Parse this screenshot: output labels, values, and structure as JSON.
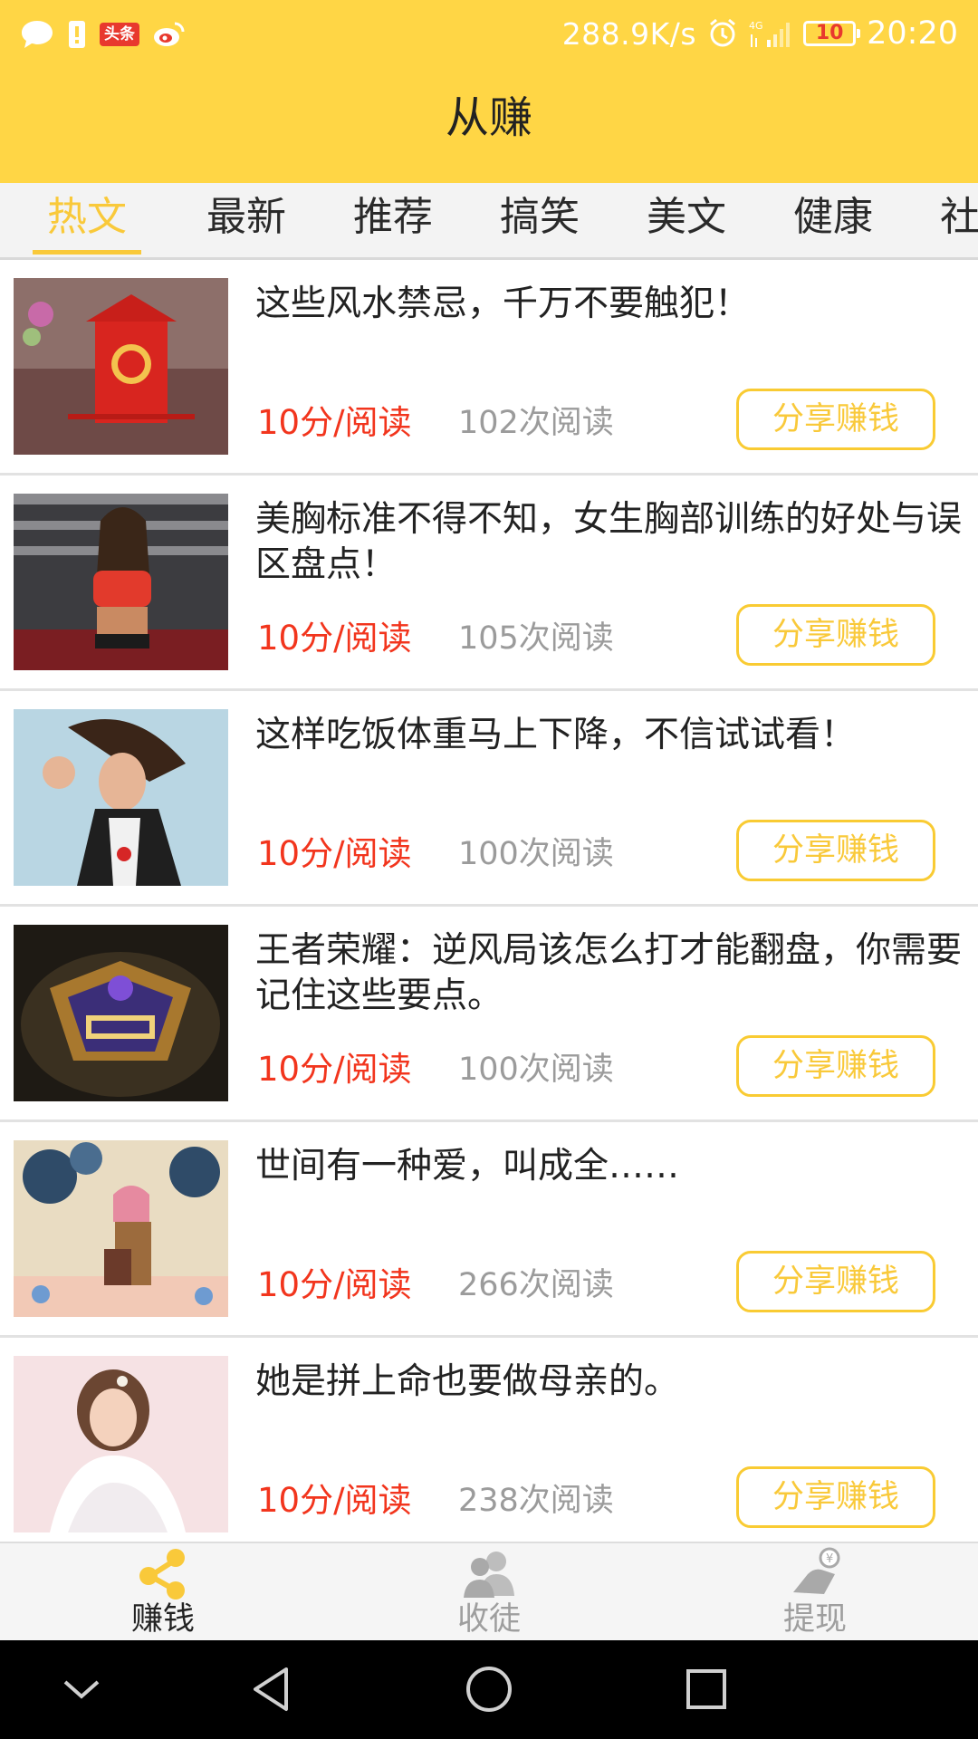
{
  "status_bar": {
    "net_speed": "288.9K/s",
    "network": "4G",
    "battery": "10",
    "time": "20:20",
    "toutiao_badge": "头条",
    "icons": [
      "message-icon",
      "sim-alert-icon",
      "toutiao-icon",
      "weibo-icon",
      "alarm-icon",
      "signal-icon",
      "battery-icon"
    ]
  },
  "app_title": "从赚",
  "tabs": [
    "热文",
    "最新",
    "推荐",
    "搞笑",
    "美文",
    "健康",
    "社"
  ],
  "active_tab": "热文",
  "articles": [
    {
      "title": "这些风水禁忌，千万不要触犯！",
      "price": "10分/阅读",
      "reads": "102次阅读",
      "button": "分享赚钱"
    },
    {
      "title": "美胸标准不得不知，女生胸部训练的好处与误区盘点！",
      "price": "10分/阅读",
      "reads": "105次阅读",
      "button": "分享赚钱"
    },
    {
      "title": "这样吃饭体重马上下降，不信试试看！",
      "price": "10分/阅读",
      "reads": "100次阅读",
      "button": "分享赚钱"
    },
    {
      "title": "王者荣耀：逆风局该怎么打才能翻盘，你需要记住这些要点。",
      "price": "10分/阅读",
      "reads": "100次阅读",
      "button": "分享赚钱"
    },
    {
      "title": "世间有一种爱，叫成全……",
      "price": "10分/阅读",
      "reads": "266次阅读",
      "button": "分享赚钱"
    },
    {
      "title": "她是拼上命也要做母亲的。",
      "price": "10分/阅读",
      "reads": "238次阅读",
      "button": "分享赚钱"
    }
  ],
  "bottom_nav": [
    {
      "label": "赚钱",
      "icon": "share-icon",
      "active": true
    },
    {
      "label": "收徒",
      "icon": "users-icon",
      "active": false
    },
    {
      "label": "提现",
      "icon": "withdraw-icon",
      "active": false
    }
  ],
  "system_nav": [
    "chevron-down-icon",
    "back-icon",
    "home-icon",
    "recents-icon"
  ],
  "colors": {
    "header": "#FFD645",
    "accent": "#F9C93A",
    "price": "#F2351D",
    "muted": "#9B9B9B"
  }
}
